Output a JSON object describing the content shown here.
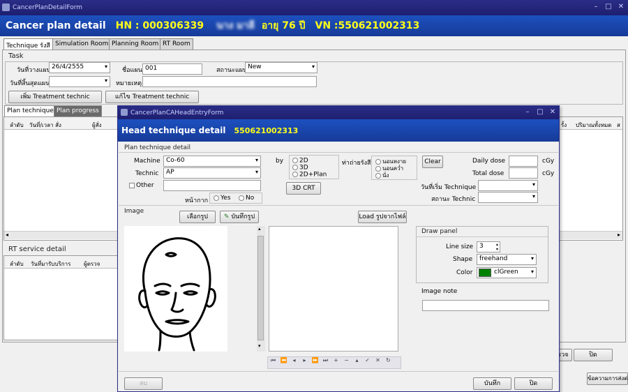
{
  "main_window": {
    "title": "CancerPlanDetailForm",
    "header": {
      "title": "Cancer plan detail",
      "hn": "HN : 000306339",
      "patient_name": "นาง  มาลี",
      "age": "อายุ 76 ปี",
      "vn": "VN :550621002313"
    },
    "tabs": [
      "Technique รังสี",
      "Simulation Room",
      "Planning Room",
      "RT Room"
    ],
    "task": {
      "title": "Task",
      "plan_date_label": "วันที่วางแผน",
      "plan_date_value": "26/4/2555",
      "plan_name_label": "ชื่อแผน",
      "plan_name_value": "001",
      "plan_status_label": "สถานะแผน",
      "plan_status_value": "New",
      "end_date_label": "วันที่สิ้นสุดแผน",
      "note_label": "หมายเหตุ",
      "add_technic_button": "เพิ่ม Treatment technic",
      "edit_technic_button": "แก้ไข Treatment technic"
    },
    "sub_tabs": [
      "Plan technique",
      "Plan progress"
    ],
    "plan_columns": [
      "ลำดับ",
      "วันที่/เวลา สั่ง",
      "ผู้สั่ง"
    ],
    "plan_columns_right": [
      "รั้ง",
      "ปริมาณทั้งหมด",
      "ส"
    ],
    "rt_service": {
      "title": "RT  service detail",
      "columns": [
        "ลำดับ",
        "วันที่มารับบริการ",
        "ผู้ตรวจ"
      ]
    },
    "bottom_buttons": {
      "check": "รวจ",
      "close": "ปิด",
      "message": "ข้อความการส่งต่อ"
    }
  },
  "dialog": {
    "title": "CancerPlanCAHeadEntryForm",
    "header_title": "Head technique detail",
    "header_vn": "550621002313",
    "section_title": "Plan technique detail",
    "machine_label": "Machine",
    "machine_value": "Co-60",
    "technic_label": "Technic",
    "technic_value": "AP",
    "other_label": "Other",
    "mask_label": "หน้ากาก",
    "mask_yes": "Yes",
    "mask_no": "No",
    "by_label": "by",
    "by_options": [
      "2D",
      "3D",
      "2D+Plan"
    ],
    "crt_button": "3D CRT",
    "photo_label": "ท่าถ่ายรังสี",
    "photo_options": [
      "นอนหงาย",
      "นอนคว่ำ",
      "นั่ง"
    ],
    "clear_button": "Clear",
    "daily_dose_label": "Daily dose",
    "daily_dose_unit": "cGy",
    "total_dose_label": "Total dose",
    "total_dose_unit": "cGy",
    "start_technic_label": "วันที่เริ่ม Technique",
    "status_technic_label": "สถานะ Technic",
    "image_label": "Image",
    "select_image_button": "เลือกรูป",
    "save_image_button": "บันทึกรูป",
    "load_image_button": "Load รูปจากไฟล์",
    "draw_panel": {
      "title": "Draw panel",
      "line_size_label": "Line size",
      "line_size_value": "3",
      "shape_label": "Shape",
      "shape_value": "freehand",
      "color_label": "Color",
      "color_value": "clGreen",
      "color_swatch": "#008000"
    },
    "image_note_label": "Image note",
    "delete_button": "ลบ",
    "save_button": "บันทึก",
    "close_button": "ปิด"
  }
}
